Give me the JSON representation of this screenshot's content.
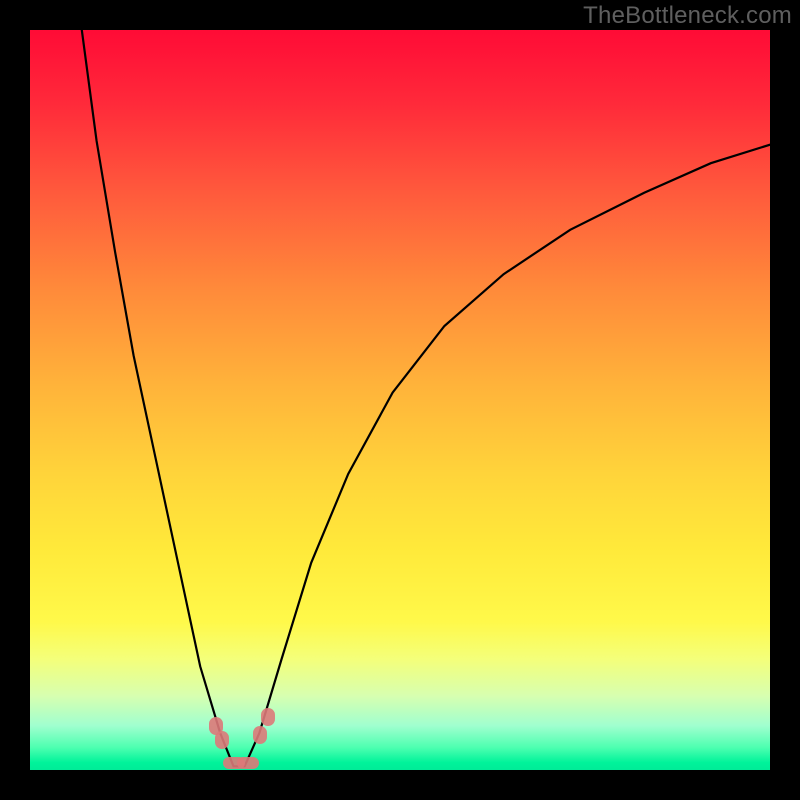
{
  "watermark": "TheBottleneck.com",
  "chart_data": {
    "type": "line",
    "title": "",
    "xlabel": "",
    "ylabel": "",
    "xlim": [
      0,
      1
    ],
    "ylim": [
      0,
      1
    ],
    "note": "Axes are normalized 0–1. Curve is a V-shape with minimum near x≈0.28; left branch rises steeply to y≈1 at x≈0.07, right branch asymptotes toward y≈0.85 at x=1.",
    "series": [
      {
        "name": "curve",
        "x": [
          0.07,
          0.09,
          0.115,
          0.14,
          0.17,
          0.2,
          0.23,
          0.257,
          0.275,
          0.29,
          0.31,
          0.34,
          0.38,
          0.43,
          0.49,
          0.56,
          0.64,
          0.73,
          0.83,
          0.92,
          1.0
        ],
        "y": [
          1.0,
          0.85,
          0.7,
          0.56,
          0.42,
          0.28,
          0.14,
          0.05,
          0.005,
          0.005,
          0.05,
          0.15,
          0.28,
          0.4,
          0.51,
          0.6,
          0.67,
          0.73,
          0.78,
          0.82,
          0.845
        ]
      }
    ],
    "markers": [
      {
        "x": 0.252,
        "y": 0.06,
        "size": "small"
      },
      {
        "x": 0.259,
        "y": 0.04,
        "size": "small"
      },
      {
        "x": 0.275,
        "y": 0.01,
        "size": "wide"
      },
      {
        "x": 0.295,
        "y": 0.01,
        "size": "wide"
      },
      {
        "x": 0.311,
        "y": 0.047,
        "size": "small"
      },
      {
        "x": 0.321,
        "y": 0.072,
        "size": "small"
      }
    ]
  },
  "colors": {
    "gradient_top": "#ff0b36",
    "gradient_bottom": "#00ec98",
    "marker": "#dd7979",
    "curve": "#000000",
    "frame": "#000000",
    "watermark": "#5f5f5f"
  }
}
